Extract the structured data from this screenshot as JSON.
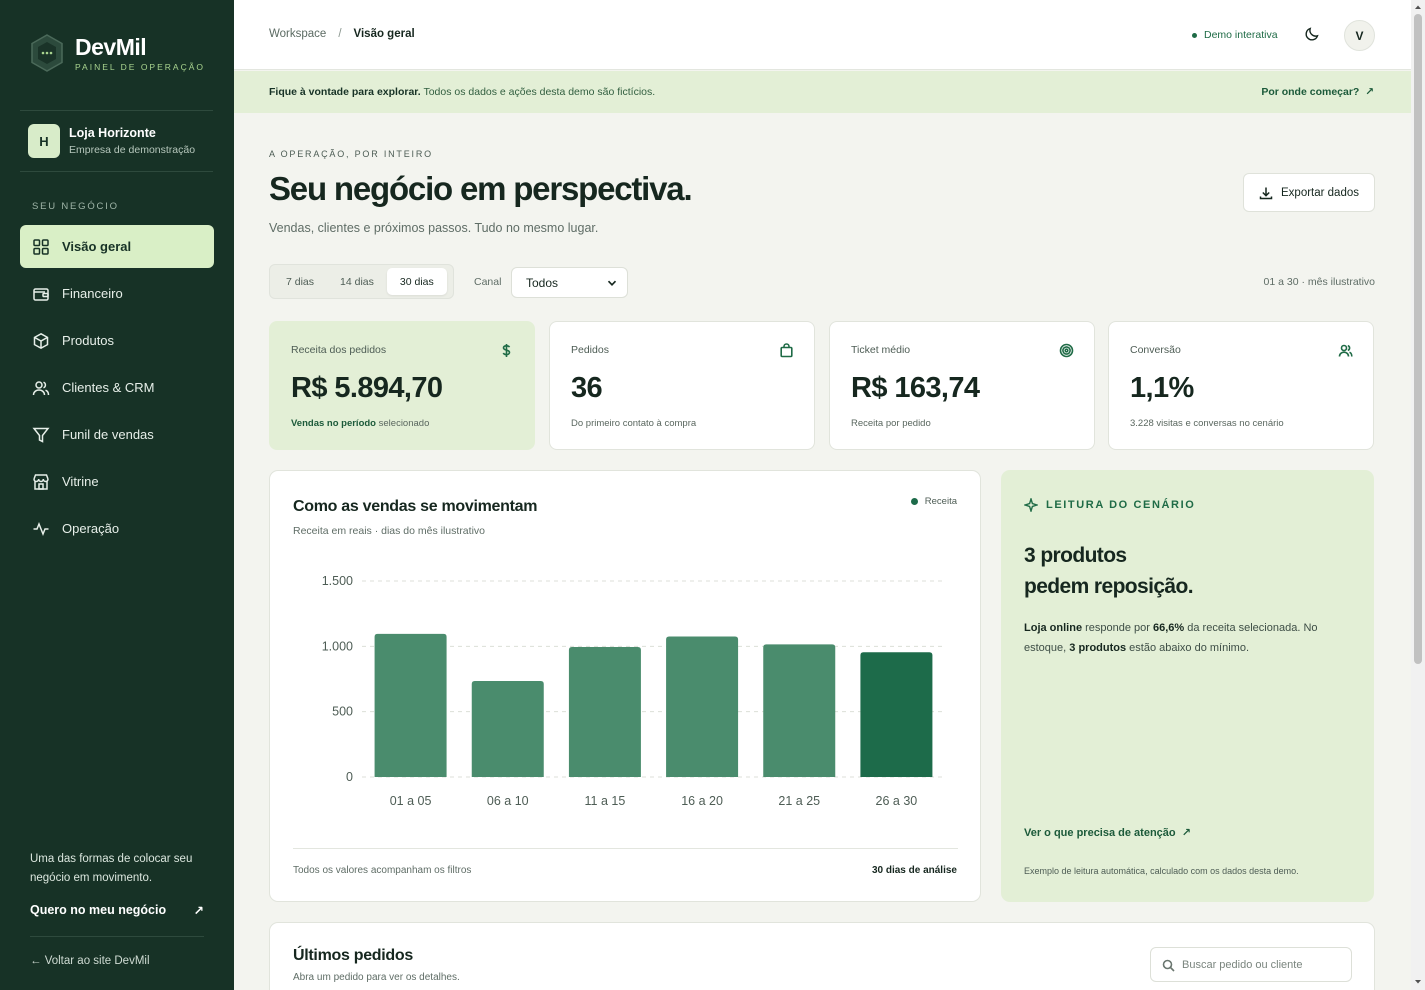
{
  "brand": {
    "name": "DevMil",
    "tagline": "PAINEL DE OPERAÇÃO"
  },
  "workspace": {
    "initial": "H",
    "name": "Loja Horizonte",
    "subtitle": "Empresa de demonstração"
  },
  "sidebar": {
    "section_label": "SEU NEGÓCIO",
    "items": [
      {
        "label": "Visão geral",
        "icon": "grid-icon",
        "active": true
      },
      {
        "label": "Financeiro",
        "icon": "wallet-icon"
      },
      {
        "label": "Produtos",
        "icon": "box-icon"
      },
      {
        "label": "Clientes & CRM",
        "icon": "users-icon"
      },
      {
        "label": "Funil de vendas",
        "icon": "funnel-icon"
      },
      {
        "label": "Vitrine",
        "icon": "store-icon"
      },
      {
        "label": "Operação",
        "icon": "activity-icon"
      }
    ],
    "promo_text": "Uma das formas de colocar seu negócio em movimento.",
    "promo_link": "Quero no meu negócio",
    "back_link": "← Voltar ao site DevMil"
  },
  "topbar": {
    "breadcrumb_root": "Workspace",
    "breadcrumb_separator": "/",
    "breadcrumb_current": "Visão geral",
    "demo_label": "Demo interativa",
    "user_initial": "V"
  },
  "notice": {
    "bold": "Fique à vontade para explorar.",
    "text": "Todos os dados e ações desta demo são fictícios.",
    "link": "Por onde começar?"
  },
  "header": {
    "eyebrow": "A OPERAÇÃO, POR INTEIRO",
    "title": "Seu negócio em perspectiva.",
    "subtitle": "Vendas, clientes e próximos passos. Tudo no mesmo lugar.",
    "export_label": "Exportar dados"
  },
  "filters": {
    "periods": [
      "7 dias",
      "14 dias",
      "30 dias"
    ],
    "active_period": "30 dias",
    "canal_label": "Canal",
    "canal_value": "Todos",
    "range_label": "01 a 30 · mês ilustrativo"
  },
  "kpis": [
    {
      "label": "Receita dos pedidos",
      "value": "R$ 5.894,70",
      "note_bold": "Vendas no período",
      "note": "selecionado",
      "icon": "dollar-icon"
    },
    {
      "label": "Pedidos",
      "value": "36",
      "note_bold": "",
      "note": "Do primeiro contato à compra",
      "icon": "bag-icon"
    },
    {
      "label": "Ticket médio",
      "value": "R$ 163,74",
      "note_bold": "",
      "note": "Receita por pedido",
      "icon": "target-icon"
    },
    {
      "label": "Conversão",
      "value": "1,1%",
      "note_bold": "",
      "note": "3.228 visitas e conversas no cenário",
      "icon": "users-icon"
    }
  ],
  "chart_card": {
    "title": "Como as vendas se movimentam",
    "subtitle": "Receita em reais · dias do mês ilustrativo",
    "footer_left": "Todos os valores acompanham os filtros",
    "footer_right": "30 dias de análise"
  },
  "chart_data": {
    "type": "bar",
    "categories": [
      "01 a 05",
      "06 a 10",
      "11 a 15",
      "16 a 20",
      "21 a 25",
      "26 a 30"
    ],
    "series": [
      {
        "name": "Receita",
        "values": [
          1095,
          735,
          995,
          1075,
          1015,
          955
        ]
      }
    ],
    "y_ticks": [
      "0",
      "500",
      "1.000",
      "1.500"
    ],
    "ylim": [
      0,
      1500
    ],
    "grid": true,
    "legend_position": "top-right",
    "bar_color": "#4a8c6d",
    "highlight_color": "#1d6b4a",
    "highlight_index": 5
  },
  "insight": {
    "tag": "LEITURA DO CENÁRIO",
    "title_line1": "3 produtos",
    "title_line2": "pedem reposição.",
    "body_part1": "Loja online",
    "body_part2": " responde por ",
    "body_part3": "66,6%",
    "body_part4": " da receita selecionada. No estoque, ",
    "body_part5": "3 produtos",
    "body_part6": " estão abaixo do mínimo.",
    "link": "Ver o que precisa de atenção",
    "footer": "Exemplo de leitura automática, calculado com os dados desta demo."
  },
  "orders": {
    "title": "Últimos pedidos",
    "subtitle": "Abra um pedido para ver os detalhes.",
    "search_placeholder": "Buscar pedido ou cliente"
  },
  "colors": {
    "sidebar_bg": "#173226",
    "accent_light": "#e3efd6",
    "accent_dark": "#1f6b46"
  }
}
